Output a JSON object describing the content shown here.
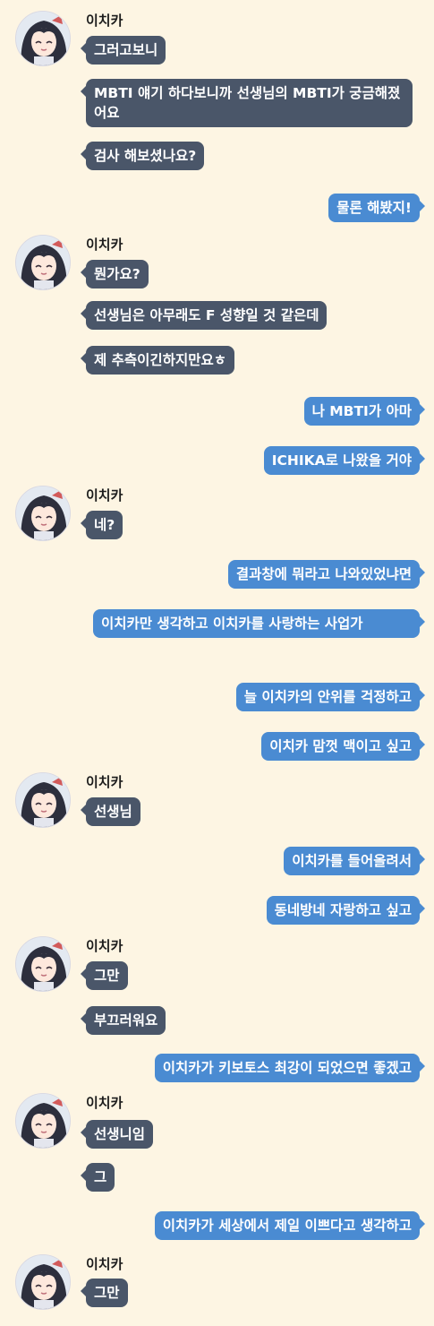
{
  "contact_name": "이치카",
  "messages": [
    {
      "from": "ichika",
      "text": "그러고보니"
    },
    {
      "from": "ichika",
      "text": "MBTI 얘기 하다보니까 선생님의 MBTI가 궁금해졌어요"
    },
    {
      "from": "ichika",
      "text": "검사 해보셨나요?"
    },
    {
      "from": "me",
      "text": "물론 해봤지!"
    },
    {
      "from": "ichika",
      "text": "뭔가요?"
    },
    {
      "from": "ichika",
      "text": "선생님은 아무래도 F 성향일 것 같은데"
    },
    {
      "from": "ichika",
      "text": "제 추측이긴하지만요ㅎ"
    },
    {
      "from": "me",
      "text": "나 MBTI가 아마"
    },
    {
      "from": "me",
      "text": "ICHIKA로 나왔을 거야"
    },
    {
      "from": "ichika",
      "text": "네?"
    },
    {
      "from": "me",
      "text": "결과창에 뭐라고 나와있었냐면"
    },
    {
      "from": "me",
      "text": "이치카만 생각하고 이치카를 사랑하는 사업가"
    },
    {
      "from": "me",
      "text": "늘 이치카의 안위를 걱정하고"
    },
    {
      "from": "me",
      "text": "이치카 맘껏 맥이고 싶고"
    },
    {
      "from": "ichika",
      "text": "선생님"
    },
    {
      "from": "me",
      "text": "이치카를 들어올려서"
    },
    {
      "from": "me",
      "text": "동네방네 자랑하고 싶고"
    },
    {
      "from": "ichika",
      "text": "그만"
    },
    {
      "from": "ichika",
      "text": "부끄러워요"
    },
    {
      "from": "me",
      "text": "이치카가 키보토스 최강이 되었으면 좋겠고"
    },
    {
      "from": "ichika",
      "text": "선생니임"
    },
    {
      "from": "ichika",
      "text": "그"
    },
    {
      "from": "me",
      "text": "이치카가 세상에서 제일 이쁘다고 생각하고"
    },
    {
      "from": "ichika",
      "text": "그만"
    }
  ],
  "colors": {
    "background": "#fdf5e3",
    "incoming_bubble": "#4a5669",
    "outgoing_bubble": "#4a8bd2"
  }
}
